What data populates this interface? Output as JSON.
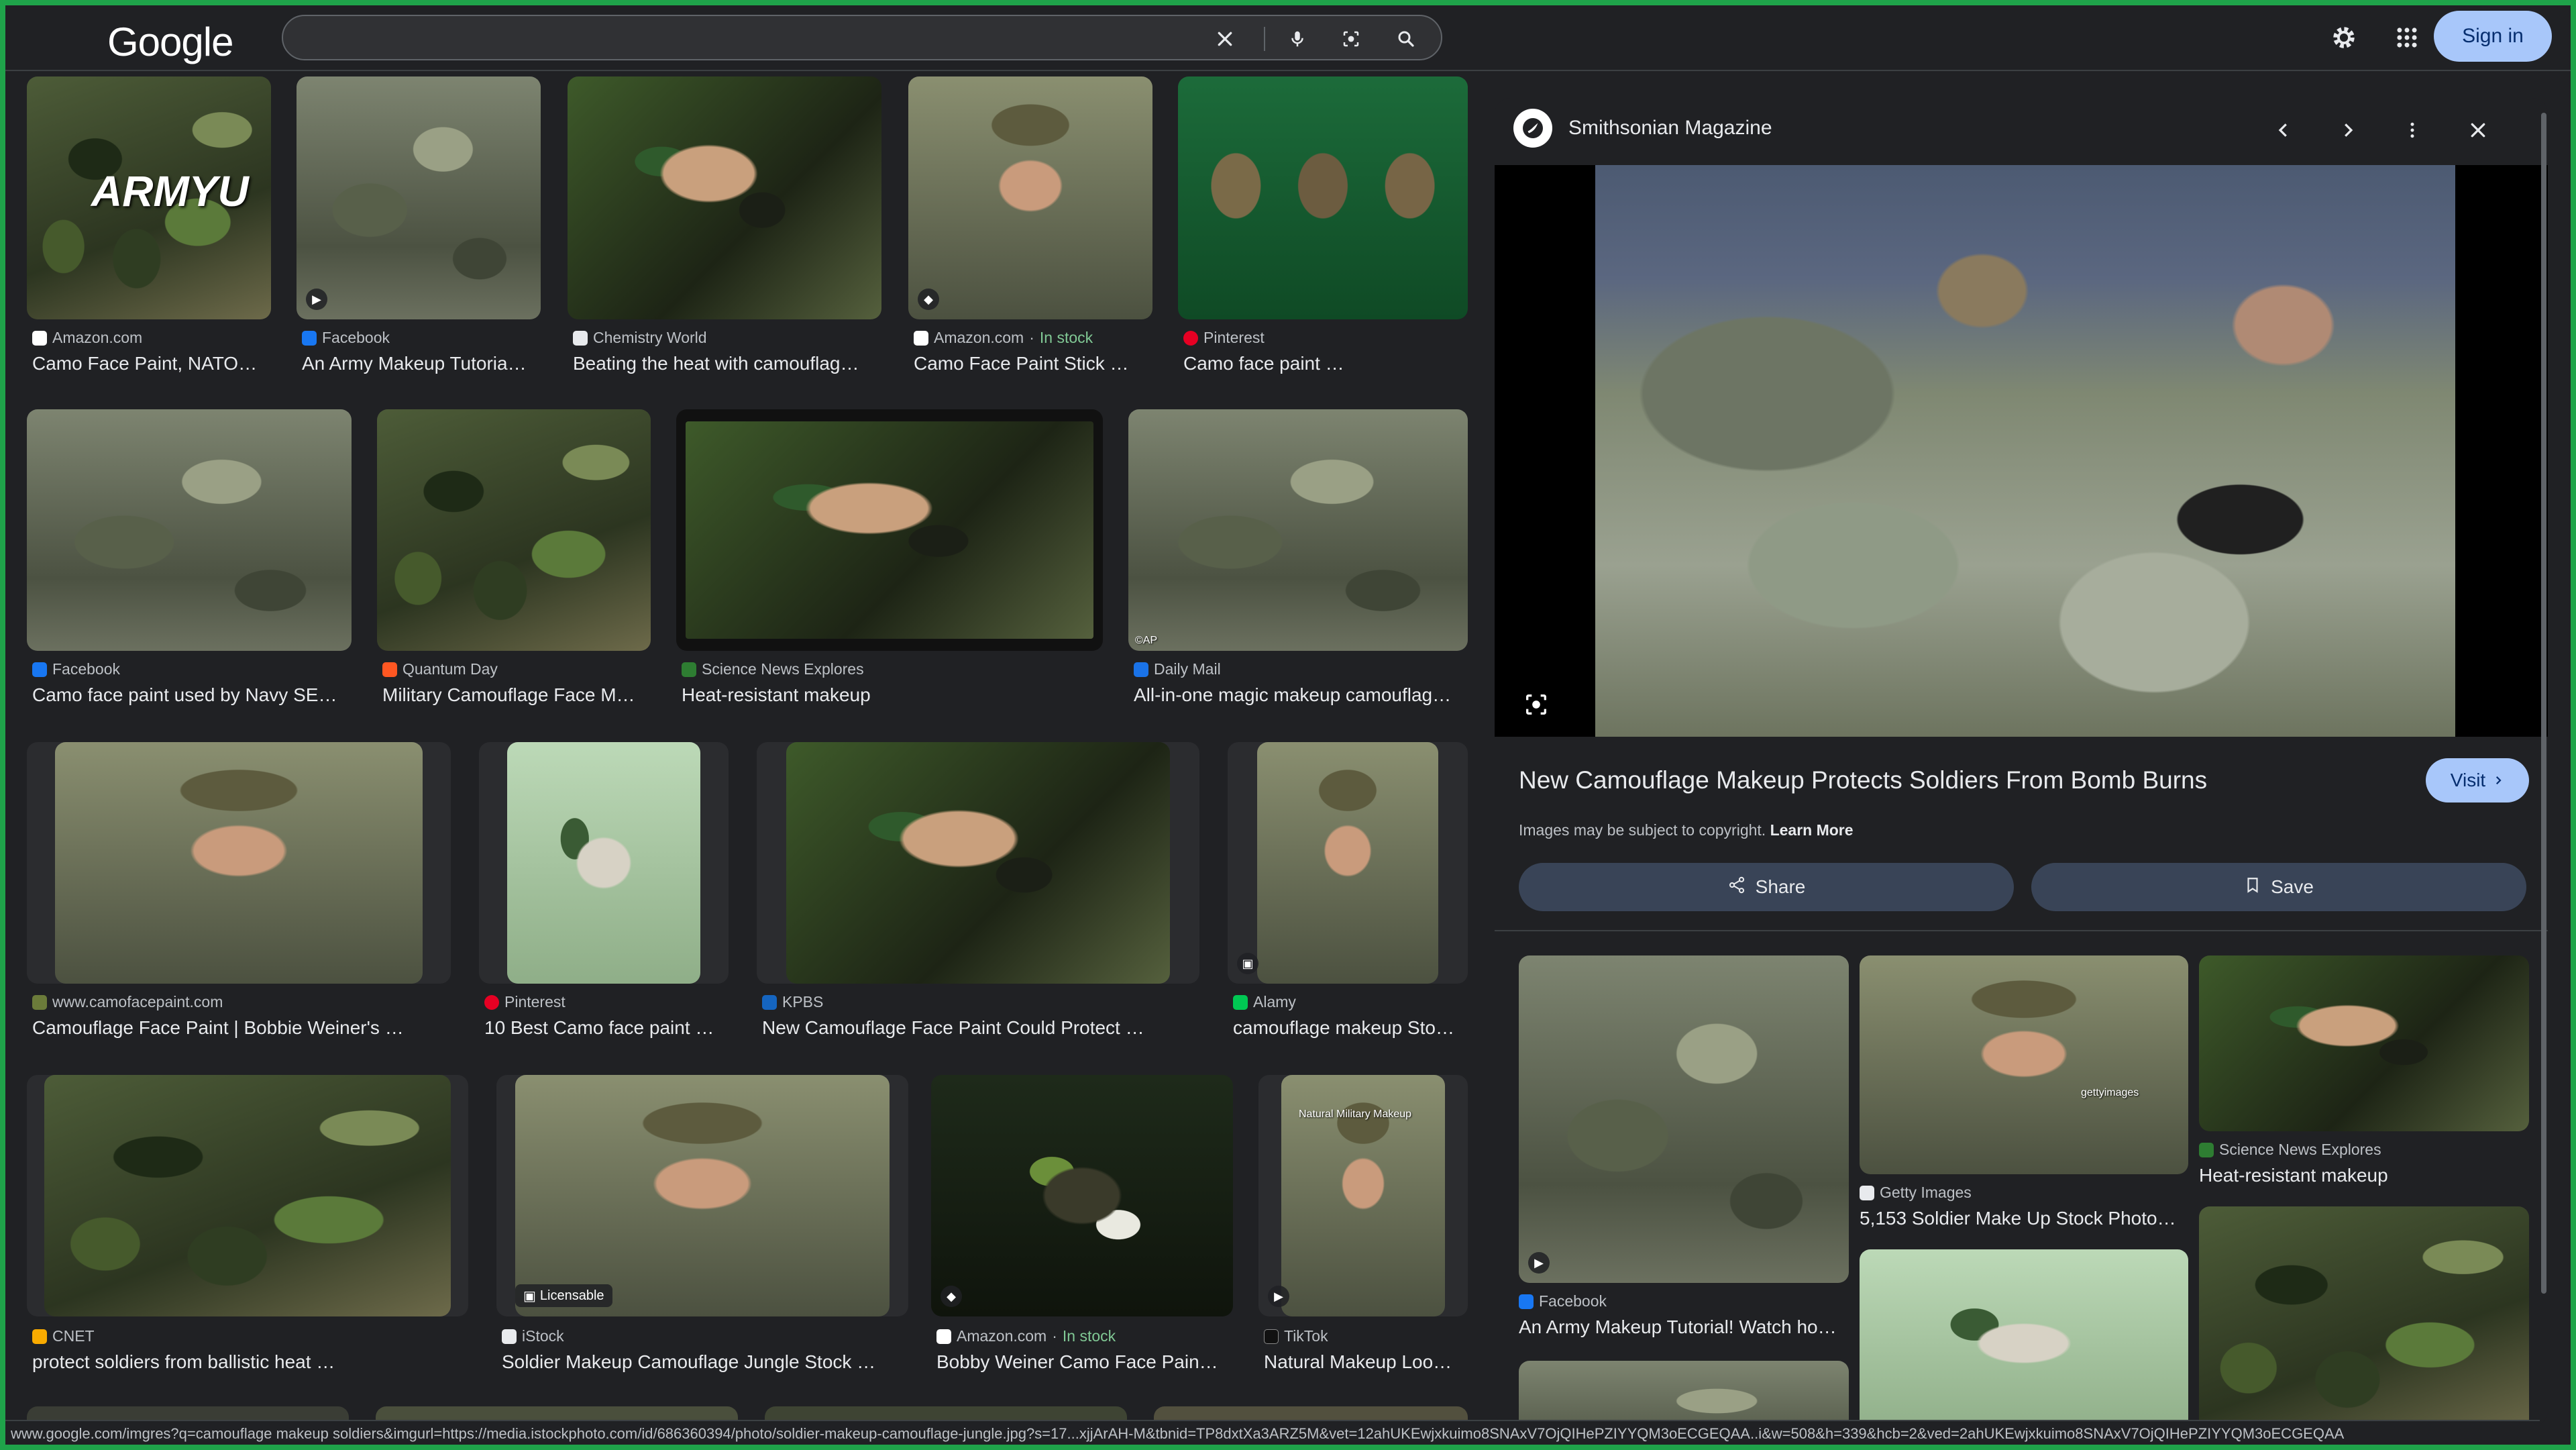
{
  "header": {
    "logo": "Google",
    "search_value": "",
    "sign_in_label": "Sign in"
  },
  "icons": {
    "clear": "close-icon",
    "voice": "microphone-icon",
    "lens": "lens-icon",
    "search": "search-icon",
    "settings": "gear-icon",
    "apps": "apps-grid-icon"
  },
  "results": [
    {
      "source": "Amazon.com",
      "stock": "",
      "title": "Camo Face Paint, NATO…",
      "overlay": "ARMYU",
      "fav": "#ffffff"
    },
    {
      "source": "Facebook",
      "stock": "",
      "title": "An Army Makeup Tutoria…",
      "fav": "#1877f2"
    },
    {
      "source": "Chemistry World",
      "stock": "",
      "title": "Beating the heat with camouflag…",
      "fav": "#e8eaed"
    },
    {
      "source": "Amazon.com",
      "stock": "In stock",
      "title": "Camo Face Paint Stick …",
      "fav": "#ffffff"
    },
    {
      "source": "Pinterest",
      "stock": "",
      "title": "Camo face paint …",
      "fav": "#e60023"
    },
    {
      "source": "Facebook",
      "stock": "",
      "title": "Camo face paint used by Navy SE…",
      "fav": "#1877f2"
    },
    {
      "source": "Quantum Day",
      "stock": "",
      "title": "Military Camouflage Face M…",
      "fav": "#ff5722"
    },
    {
      "source": "Science News Explores",
      "stock": "",
      "title": "Heat-resistant makeup",
      "fav": "#2e7d32"
    },
    {
      "source": "Daily Mail",
      "stock": "",
      "title": "All-in-one magic makeup camouflag…",
      "overlay": "©AP",
      "fav": "#1a73e8"
    },
    {
      "source": "www.camofacepaint.com",
      "stock": "",
      "title": "Camouflage Face Paint | Bobbie Weiner's …",
      "fav": "#6b7b3a"
    },
    {
      "source": "Pinterest",
      "stock": "",
      "title": "10 Best Camo face paint …",
      "fav": "#e60023"
    },
    {
      "source": "KPBS",
      "stock": "",
      "title": "New Camouflage Face Paint Could Protect …",
      "fav": "#1565c0"
    },
    {
      "source": "Alamy",
      "stock": "",
      "title": "camouflage makeup Sto…",
      "fav": "#00c853"
    },
    {
      "source": "CNET",
      "stock": "",
      "title": "protect soldiers from ballistic heat …",
      "fav": "#f9ab00"
    },
    {
      "source": "iStock",
      "stock": "",
      "title": "Soldier Makeup Camouflage Jungle Stock …",
      "badge": "Licensable",
      "fav": "#e8eaed"
    },
    {
      "source": "Amazon.com",
      "stock": "In stock",
      "title": "Bobby Weiner Camo Face Pain…",
      "fav": "#ffffff"
    },
    {
      "source": "TikTok",
      "stock": "",
      "title": "Natural Makeup Loo…",
      "overlay": "Natural Military Makeup",
      "fav": "#111111"
    }
  ],
  "panel": {
    "source": "Smithsonian Magazine",
    "title": "New Camouflage Makeup Protects Soldiers From Bomb Burns",
    "visit_label": "Visit",
    "copyright_text": "Images may be subject to copyright.",
    "learn_more": "Learn More",
    "share_label": "Share",
    "save_label": "Save",
    "related": [
      {
        "source": "Facebook",
        "title": "An Army Makeup Tutorial! Watch ho…",
        "fav": "#1877f2"
      },
      {
        "source": "Getty Images",
        "title": "5,153 Soldier Make Up Stock Photo…",
        "watermark": "gettyimages",
        "fav": "#e8eaed"
      },
      {
        "source": "Science News Explores",
        "title": "Heat-resistant makeup",
        "fav": "#2e7d32"
      }
    ]
  },
  "status_url": "www.google.com/imgres?q=camouflage makeup soldiers&imgurl=https://media.istockphoto.com/id/686360394/photo/soldier-makeup-camouflage-jungle.jpg?s=17...xjjArAH-M&tbnid=TP8dxtXa3ARZ5M&vet=12ahUKEwjxkuimo8SNAxV7OjQIHePZIYYQM3oECGEQAA..i&w=508&h=339&hcb=2&ved=2ahUKEwjxkuimo8SNAxV7OjQIHePZIYYQM3oECGEQAA"
}
